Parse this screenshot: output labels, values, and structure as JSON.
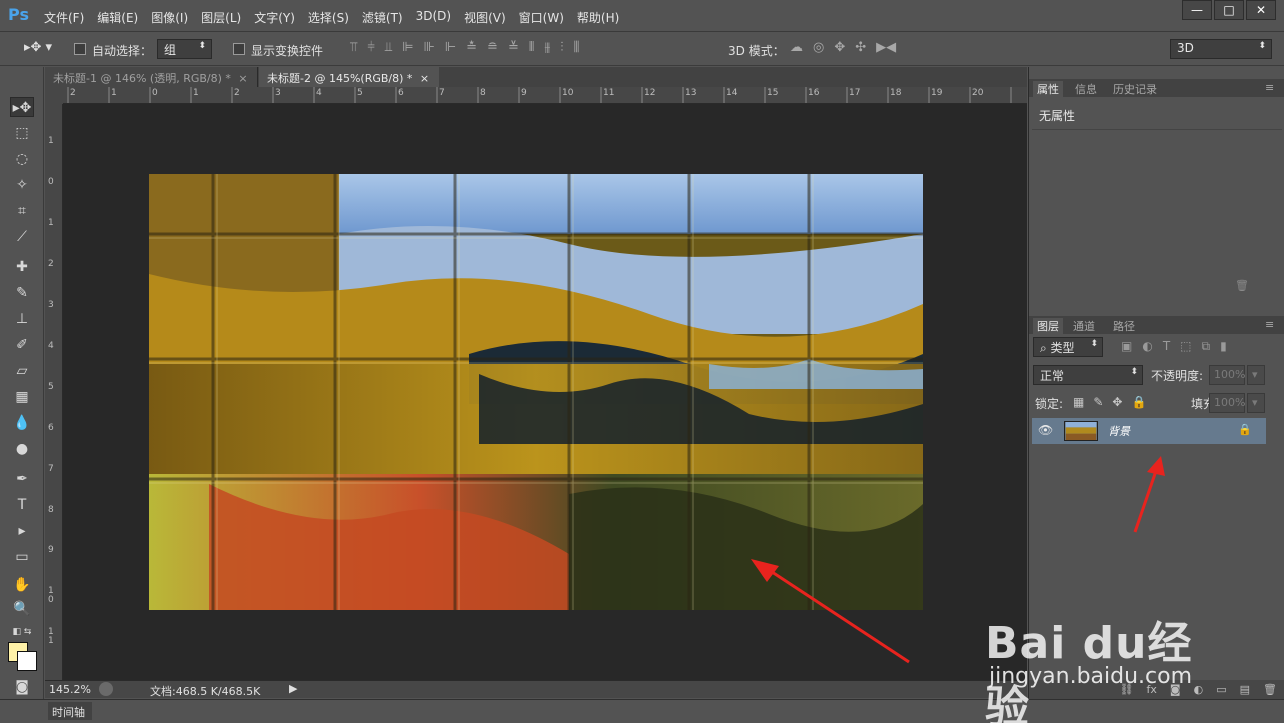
{
  "app": {
    "logo": "Ps",
    "menu": [
      "文件(F)",
      "编辑(E)",
      "图像(I)",
      "图层(L)",
      "文字(Y)",
      "选择(S)",
      "滤镜(T)",
      "3D(D)",
      "视图(V)",
      "窗口(W)",
      "帮助(H)"
    ],
    "window_controls": [
      "—",
      "□",
      "✕"
    ]
  },
  "options": {
    "auto_select_label": "自动选择：",
    "auto_select_value": "组",
    "show_transform_label": "显示变换控件",
    "mode_3d_label": "3D 模式：",
    "workspace_value": "3D"
  },
  "tabs": [
    {
      "label": "未标题-1 @ 146% (透明, RGB/8) *",
      "close": "×"
    },
    {
      "label": "未标题-2 @ 145%(RGB/8) *",
      "close": "×"
    }
  ],
  "rulers": {
    "h": [
      "2",
      "1",
      "0",
      "1",
      "2",
      "3",
      "4",
      "5",
      "6",
      "7",
      "8",
      "9",
      "10",
      "11",
      "12",
      "13",
      "14",
      "15",
      "16",
      "17",
      "18",
      "19",
      "20"
    ],
    "v": [
      "1",
      "0",
      "1",
      "2",
      "3",
      "4",
      "5",
      "6",
      "7",
      "8",
      "9",
      "1 0",
      "1 1",
      "1 2"
    ]
  },
  "status": {
    "zoom": "145.2%",
    "doc": "文档:468.5 K/468.5K",
    "timeline": "时间轴"
  },
  "properties": {
    "tabs": [
      "属性",
      "信息",
      "历史记录"
    ],
    "title": "无属性"
  },
  "layers": {
    "tabs": [
      "图层",
      "通道",
      "路径"
    ],
    "filter_kind": "类型",
    "blend_mode": "正常",
    "opacity_label": "不透明度:",
    "opacity_value": "100%",
    "lock_label": "锁定:",
    "fill_label": "填充:",
    "fill_value": "100%",
    "items": [
      {
        "name": "背景",
        "visible": true,
        "locked": true
      }
    ]
  },
  "watermark": {
    "text": "Bai du经验",
    "url": "jingyan.baidu.com"
  },
  "colors": {
    "foreground": "#fff2a8",
    "background": "#ffffff",
    "accent": "#4aa3ea",
    "annotation": "#e8231e"
  }
}
